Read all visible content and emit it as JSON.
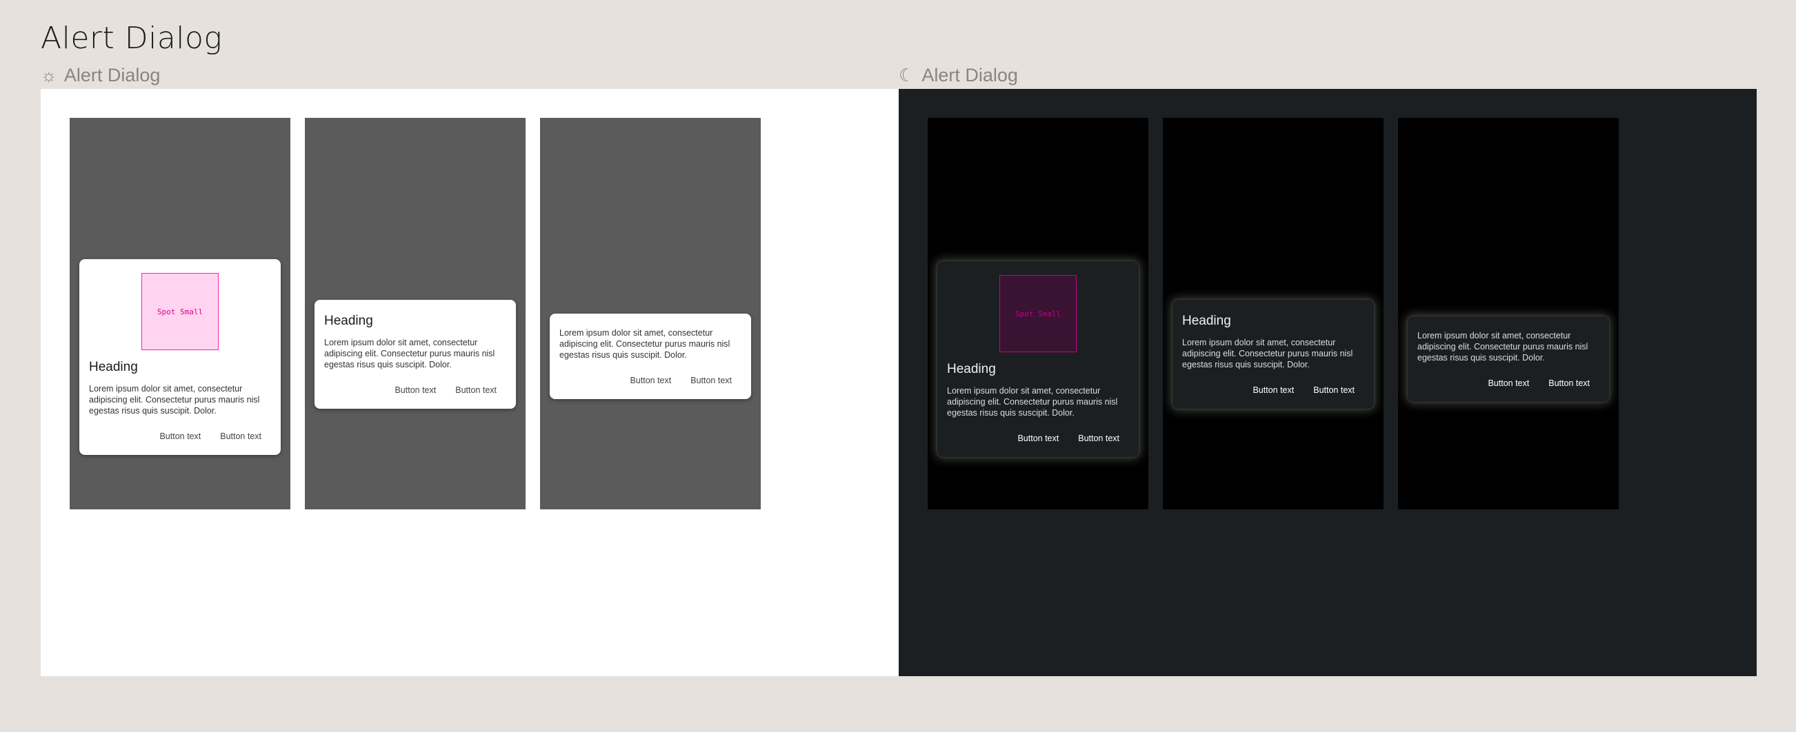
{
  "page": {
    "title": "Alert Dialog"
  },
  "sections": {
    "light": {
      "icon": "sun-icon",
      "label": "Alert Dialog"
    },
    "dark": {
      "icon": "moon-icon",
      "label": "Alert Dialog"
    }
  },
  "dialog": {
    "spot_label": "Spot Small",
    "heading": "Heading",
    "body": "Lorem ipsum dolor sit amet, consectetur adipiscing elit. Consectetur purus mauris nisl egestas risus quis suscipit. Dolor.",
    "button_1": "Button text",
    "button_2": "Button text"
  },
  "colors": {
    "canvas": "#e6e1dc",
    "light_panel": "#ffffff",
    "dark_panel": "#1c1f21",
    "scrim_light": "#5b5b5b",
    "scrim_dark": "#000000",
    "spot_accent": "#ff1fad"
  }
}
